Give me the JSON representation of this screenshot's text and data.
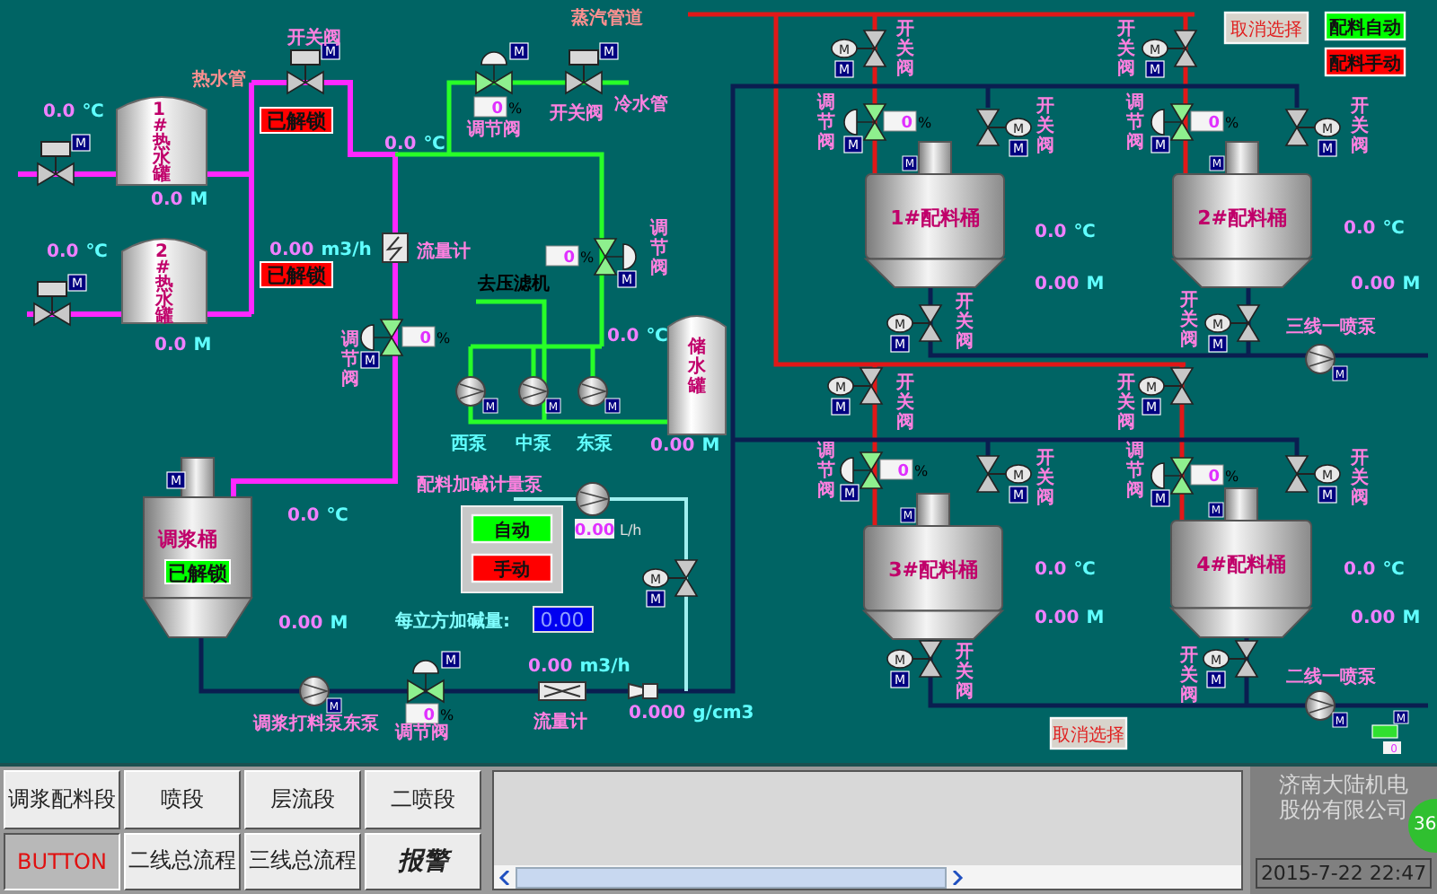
{
  "labels": [
    {
      "text": "蒸汽管道",
      "kind": "pipe"
    },
    {
      "text": "开关阀",
      "kind": "device"
    },
    {
      "text": "热水管",
      "kind": "pipe"
    },
    {
      "text": "调节阀",
      "kind": "device"
    },
    {
      "text": "开关阀",
      "kind": "device"
    },
    {
      "text": "冷水管",
      "kind": "device"
    },
    {
      "text": "流量计",
      "kind": "device"
    },
    {
      "text": "调节阀",
      "kind": "device"
    },
    {
      "text": "去压滤机",
      "kind": "note"
    },
    {
      "text": "调节阀",
      "kind": "device"
    },
    {
      "text": "西泵",
      "kind": "pump"
    },
    {
      "text": "中泵",
      "kind": "pump"
    },
    {
      "text": "东泵",
      "kind": "pump"
    },
    {
      "text": "配料加碱计量泵",
      "kind": "device"
    },
    {
      "text": "每立方加碱量:",
      "kind": "hint"
    },
    {
      "text": "调浆打料泵东泵",
      "kind": "device"
    },
    {
      "text": "调节阀",
      "kind": "device"
    },
    {
      "text": "流量计",
      "kind": "device"
    },
    {
      "text": "开关阀",
      "kind": "device"
    },
    {
      "text": "调节阀",
      "kind": "device"
    },
    {
      "text": "开关阀",
      "kind": "device"
    },
    {
      "text": "开关阀",
      "kind": "device"
    },
    {
      "text": "开关阀",
      "kind": "device"
    },
    {
      "text": "调节阀",
      "kind": "device"
    },
    {
      "text": "开关阀",
      "kind": "device"
    },
    {
      "text": "开关阀",
      "kind": "device"
    },
    {
      "text": "三线一喷泵",
      "kind": "device"
    },
    {
      "text": "开关阀",
      "kind": "device"
    },
    {
      "text": "调节阀",
      "kind": "device"
    },
    {
      "text": "开关阀",
      "kind": "device"
    },
    {
      "text": "开关阀",
      "kind": "device"
    },
    {
      "text": "开关阀",
      "kind": "device"
    },
    {
      "text": "调节阀",
      "kind": "device"
    },
    {
      "text": "开关阀",
      "kind": "device"
    },
    {
      "text": "开关阀",
      "kind": "device"
    },
    {
      "text": "二线一喷泵",
      "kind": "device"
    }
  ],
  "readings": [
    {
      "value": "0.0",
      "unit": "℃"
    },
    {
      "value": "0.0",
      "unit": "M"
    },
    {
      "value": "0.0",
      "unit": "℃"
    },
    {
      "value": "0.0",
      "unit": "M"
    },
    {
      "value": "0.0",
      "unit": "℃"
    },
    {
      "value": "0.00",
      "unit": "m3/h"
    },
    {
      "value": "0.0",
      "unit": "℃"
    },
    {
      "value": "0.00",
      "unit": "M"
    },
    {
      "value": "0.0",
      "unit": "℃"
    },
    {
      "value": "0.00",
      "unit": "M"
    },
    {
      "value": "0.00",
      "unit": "m3/h"
    },
    {
      "value": "0.000",
      "unit": "g/cm3"
    },
    {
      "value": "0.0",
      "unit": "℃"
    },
    {
      "value": "0.00",
      "unit": "M"
    },
    {
      "value": "0.0",
      "unit": "℃"
    },
    {
      "value": "0.00",
      "unit": "M"
    },
    {
      "value": "0.0",
      "unit": "℃"
    },
    {
      "value": "0.00",
      "unit": "M"
    },
    {
      "value": "0.0",
      "unit": "℃"
    },
    {
      "value": "0.00",
      "unit": "M"
    }
  ],
  "valves": [
    {
      "kind": "switch",
      "badge": "M"
    },
    {
      "kind": "switch",
      "badge": "M"
    },
    {
      "kind": "switch",
      "badge": "M"
    },
    {
      "kind": "regulating",
      "badge": "M",
      "percent": "0",
      "unit": "%"
    },
    {
      "kind": "switch",
      "badge": "M"
    },
    {
      "kind": "regulating",
      "badge": "M",
      "percent": "0",
      "unit": "%"
    },
    {
      "kind": "regulating",
      "badge": "M",
      "percent": "0",
      "unit": "%"
    },
    {
      "kind": "regulating",
      "badge": "M",
      "percent": "0",
      "unit": "%"
    },
    {
      "kind": "motor",
      "badge": "M",
      "motor": "M"
    },
    {
      "kind": "motor",
      "badge": "M",
      "motor": "M"
    },
    {
      "kind": "regulating",
      "badge": "M",
      "percent": "0",
      "unit": "%"
    },
    {
      "kind": "motor",
      "badge": "M",
      "motor": "M"
    },
    {
      "kind": "motor",
      "badge": "M",
      "motor": "M"
    },
    {
      "kind": "motor",
      "badge": "M",
      "motor": "M"
    },
    {
      "kind": "regulating",
      "badge": "M",
      "percent": "0",
      "unit": "%"
    },
    {
      "kind": "motor",
      "badge": "M",
      "motor": "M"
    },
    {
      "kind": "motor",
      "badge": "M",
      "motor": "M"
    },
    {
      "kind": "motor",
      "badge": "M",
      "motor": "M"
    },
    {
      "kind": "regulating",
      "badge": "M",
      "percent": "0",
      "unit": "%"
    },
    {
      "kind": "motor",
      "badge": "M",
      "motor": "M"
    },
    {
      "kind": "motor",
      "badge": "M",
      "motor": "M"
    },
    {
      "kind": "motor",
      "badge": "M",
      "motor": "M"
    },
    {
      "kind": "regulating",
      "badge": "M",
      "percent": "0",
      "unit": "%"
    },
    {
      "kind": "motor",
      "badge": "M",
      "motor": "M"
    },
    {
      "kind": "motor",
      "badge": "M",
      "motor": "M"
    }
  ],
  "pumps": [
    {
      "badge": "M"
    },
    {
      "badge": "M"
    },
    {
      "badge": "M"
    },
    {
      "badge": "M"
    },
    {
      "badge": "M"
    },
    {
      "badge": "M"
    }
  ],
  "hot_water_tanks": [
    {
      "name": "1#热水罐"
    },
    {
      "name": "2#热水罐"
    }
  ],
  "water_tank": {
    "name": "储水罐"
  },
  "mix_tank": {
    "name": "调浆桶",
    "badge": "M"
  },
  "batch_tanks": [
    {
      "name": "1#配料桶",
      "badge": "M"
    },
    {
      "name": "2#配料桶",
      "badge": "M"
    },
    {
      "name": "3#配料桶",
      "badge": "M"
    },
    {
      "name": "4#配料桶",
      "badge": "M"
    }
  ],
  "lock_buttons": [
    {
      "text": "已解锁",
      "color": "#ff0000"
    },
    {
      "text": "已解锁",
      "color": "#ff0000"
    },
    {
      "text": "已解锁",
      "color": "#00ff00"
    }
  ],
  "mode_buttons": [
    {
      "text": "取消选择",
      "kind": "cancel"
    },
    {
      "text": "配料自动",
      "kind": "mode",
      "color": "#00ff00"
    },
    {
      "text": "配料手动",
      "kind": "mode",
      "color": "#ff0000"
    },
    {
      "text": "自动",
      "kind": "mode",
      "color": "#00ff00"
    },
    {
      "text": "手动",
      "kind": "mode",
      "color": "#ff0000"
    },
    {
      "text": "取消选择",
      "kind": "cancel"
    }
  ],
  "metering_pump": {
    "value": "0.00",
    "unit": "L/h"
  },
  "dosage_field": {
    "value": "0.00"
  },
  "status_lamp": {
    "badge": "M",
    "value": "0"
  },
  "nav_buttons": [
    {
      "text": "调浆配料段",
      "kind": "section",
      "selected": false
    },
    {
      "text": "喷段",
      "kind": "section",
      "selected": false
    },
    {
      "text": "层流段",
      "kind": "section",
      "selected": false
    },
    {
      "text": "二喷段",
      "kind": "section",
      "selected": false
    },
    {
      "text": "BUTTON",
      "kind": "test",
      "selected": true
    },
    {
      "text": "二线总流程",
      "kind": "section",
      "selected": false
    },
    {
      "text": "三线总流程",
      "kind": "section",
      "selected": false
    },
    {
      "text": "报警",
      "kind": "alarm",
      "selected": false
    }
  ],
  "company": "济南大陆机电股份有限公司",
  "datetime": "2015-7-22 22:47",
  "floating_ball": "36"
}
